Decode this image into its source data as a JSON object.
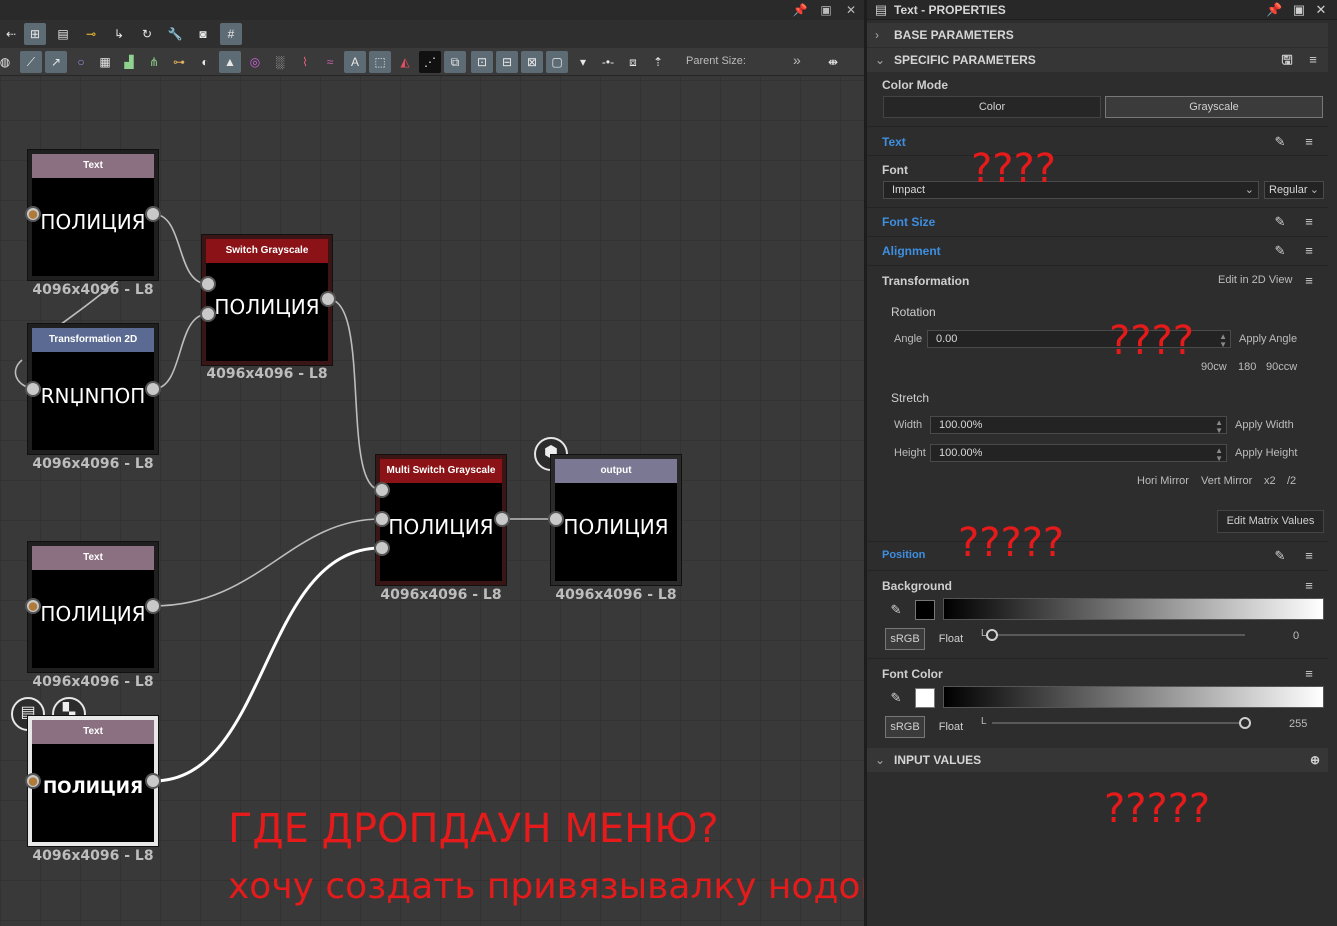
{
  "graph": {
    "toolbar": {
      "parent_size_label": "Parent Size:",
      "more": "»"
    },
    "nodes": [
      {
        "title": "Text",
        "preview": "ПОЛИЦИЯ",
        "res": "4096x4096 - L8"
      },
      {
        "title": "Transformation 2D",
        "preview": "RNЏNΠOΠ",
        "res": "4096x4096 - L8"
      },
      {
        "title": "Switch Grayscale",
        "preview": "ПОЛИЦИЯ",
        "res": "4096x4096 - L8"
      },
      {
        "title": "Text",
        "preview": "ПОЛИЦИЯ",
        "res": "4096x4096 - L8"
      },
      {
        "title": "Text",
        "preview": "ПОЛИЦИЯ",
        "res": "4096x4096 - L8"
      },
      {
        "title": "Multi Switch Grayscale",
        "preview": "ПОЛИЦИЯ",
        "res": "4096x4096 - L8"
      },
      {
        "title": "output",
        "preview": "ПОЛИЦИЯ",
        "res": "4096x4096 - L8"
      }
    ],
    "colors": {
      "text_header": "#8a7080",
      "switch_header": "#8b1216",
      "transform_header": "#5a6a93",
      "output_header": "#7a7892"
    }
  },
  "annotations": {
    "q1": "????",
    "q2": "????",
    "q3": "?????",
    "q4": "?????",
    "headline": "ГДЕ ДРОПДАУН МЕНЮ?",
    "subline": "хочу создать привязывалку нодов к отображению"
  },
  "props": {
    "title": "Text - PROPERTIES",
    "base_parameters": "BASE PARAMETERS",
    "specific_parameters": "SPECIFIC PARAMETERS",
    "color_mode": {
      "label": "Color Mode",
      "options": [
        "Color",
        "Grayscale"
      ],
      "selected": "Grayscale"
    },
    "text_label": "Text",
    "font": {
      "label": "Font",
      "value": "Impact",
      "style": "Regular"
    },
    "font_size_label": "Font Size",
    "alignment_label": "Alignment",
    "transformation": {
      "label": "Transformation",
      "edit_2d": "Edit in 2D View",
      "rotation_label": "Rotation",
      "angle_label": "Angle",
      "angle_value": "0.00",
      "apply_angle": "Apply Angle",
      "rot_buttons": [
        "90cw",
        "180",
        "90ccw"
      ],
      "stretch_label": "Stretch",
      "width_label": "Width",
      "width_value": "100.00%",
      "apply_width": "Apply Width",
      "height_label": "Height",
      "height_value": "100.00%",
      "apply_height": "Apply Height",
      "mirror_buttons": [
        "Hori Mirror",
        "Vert Mirror",
        "x2",
        "/2"
      ],
      "edit_matrix": "Edit Matrix Values"
    },
    "position_label": "Position",
    "background": {
      "label": "Background",
      "srgb": "sRGB",
      "float": "Float",
      "channel": "L",
      "value": "0",
      "level": 0.0,
      "swatch": "#000000"
    },
    "font_color": {
      "label": "Font Color",
      "srgb": "sRGB",
      "float": "Float",
      "channel": "L",
      "value": "255",
      "level": 1.0,
      "swatch": "#ffffff"
    },
    "input_values": "INPUT VALUES"
  }
}
